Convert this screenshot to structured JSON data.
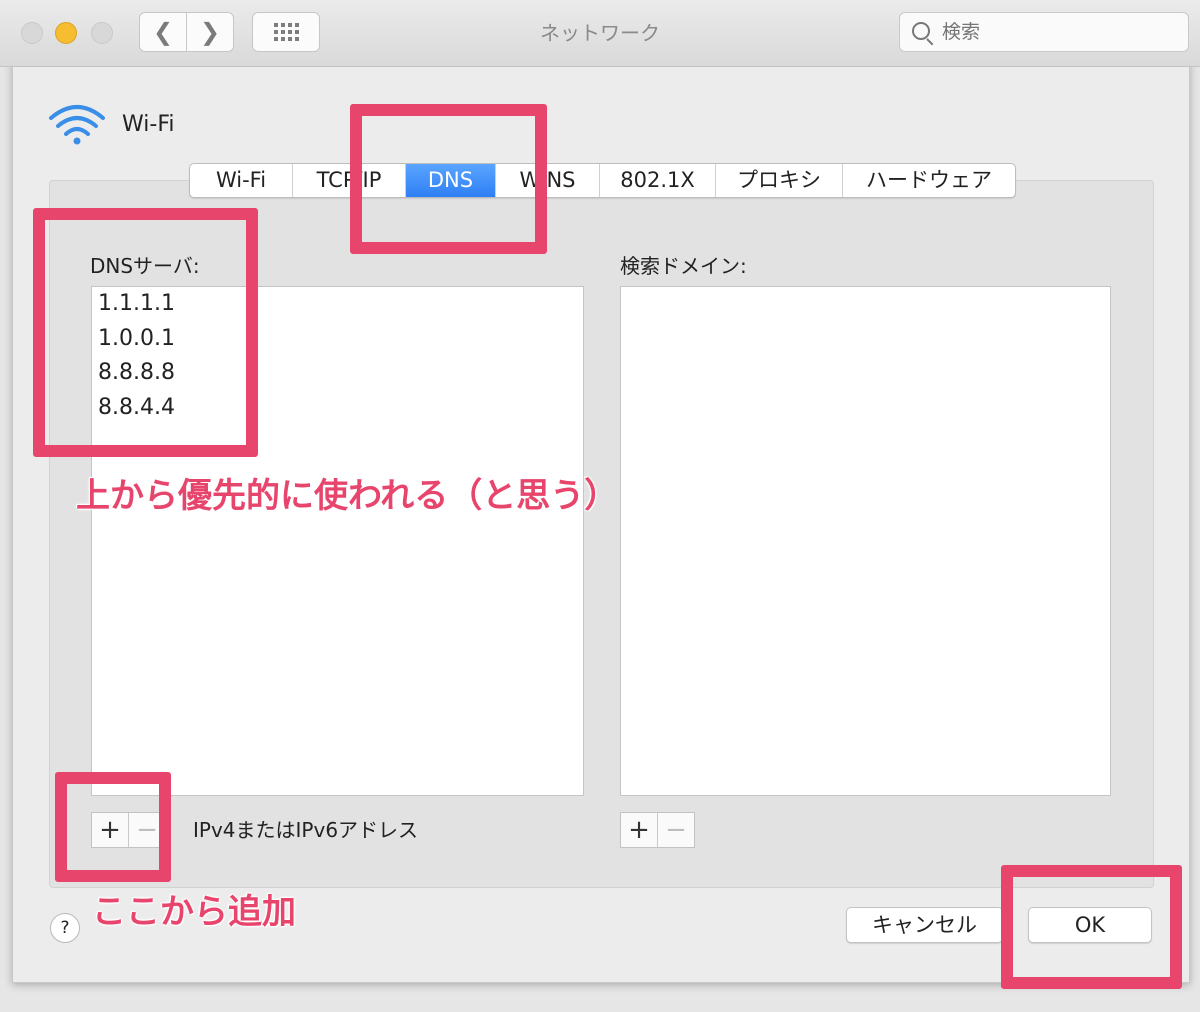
{
  "window": {
    "title": "ネットワーク"
  },
  "search": {
    "placeholder": "検索"
  },
  "interface": {
    "name": "Wi-Fi"
  },
  "tabs": [
    {
      "label": "Wi-Fi",
      "active": false
    },
    {
      "label": "TCP/IP",
      "active": false
    },
    {
      "label": "DNS",
      "active": true
    },
    {
      "label": "WINS",
      "active": false
    },
    {
      "label": "802.1X",
      "active": false
    },
    {
      "label": "プロキシ",
      "active": false
    },
    {
      "label": "ハードウェア",
      "active": false
    }
  ],
  "dns": {
    "label": "DNSサーバ:",
    "servers": [
      "1.1.1.1",
      "1.0.0.1",
      "8.8.8.8",
      "8.8.4.4"
    ],
    "hint": "IPv4またはIPv6アドレス"
  },
  "search_domains": {
    "label": "検索ドメイン:"
  },
  "buttons": {
    "plus": "+",
    "minus": "−",
    "help": "?",
    "cancel": "キャンセル",
    "ok": "OK"
  },
  "annotations": {
    "priority_note": "上から優先的に使われる（と思う）",
    "add_note": "ここから追加",
    "color": "#e8456d"
  }
}
